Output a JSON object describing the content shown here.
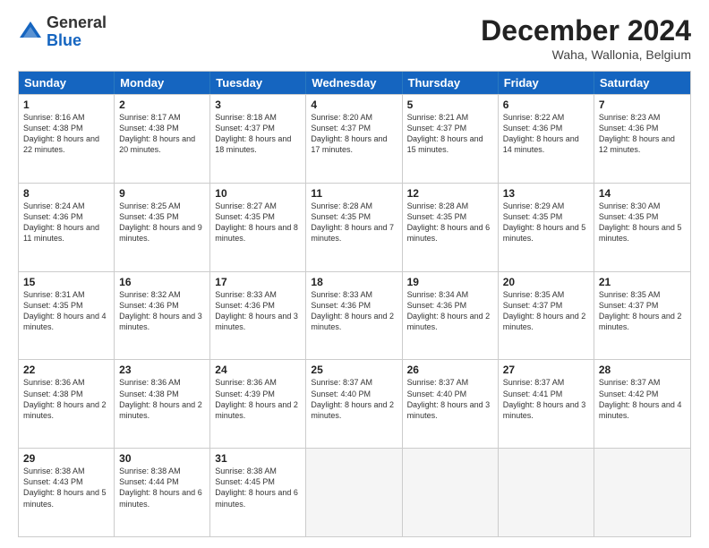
{
  "logo": {
    "general": "General",
    "blue": "Blue"
  },
  "title": "December 2024",
  "subtitle": "Waha, Wallonia, Belgium",
  "header_days": [
    "Sunday",
    "Monday",
    "Tuesday",
    "Wednesday",
    "Thursday",
    "Friday",
    "Saturday"
  ],
  "rows": [
    [
      {
        "day": "1",
        "info": "Sunrise: 8:16 AM\nSunset: 4:38 PM\nDaylight: 8 hours and 22 minutes."
      },
      {
        "day": "2",
        "info": "Sunrise: 8:17 AM\nSunset: 4:38 PM\nDaylight: 8 hours and 20 minutes."
      },
      {
        "day": "3",
        "info": "Sunrise: 8:18 AM\nSunset: 4:37 PM\nDaylight: 8 hours and 18 minutes."
      },
      {
        "day": "4",
        "info": "Sunrise: 8:20 AM\nSunset: 4:37 PM\nDaylight: 8 hours and 17 minutes."
      },
      {
        "day": "5",
        "info": "Sunrise: 8:21 AM\nSunset: 4:37 PM\nDaylight: 8 hours and 15 minutes."
      },
      {
        "day": "6",
        "info": "Sunrise: 8:22 AM\nSunset: 4:36 PM\nDaylight: 8 hours and 14 minutes."
      },
      {
        "day": "7",
        "info": "Sunrise: 8:23 AM\nSunset: 4:36 PM\nDaylight: 8 hours and 12 minutes."
      }
    ],
    [
      {
        "day": "8",
        "info": "Sunrise: 8:24 AM\nSunset: 4:36 PM\nDaylight: 8 hours and 11 minutes."
      },
      {
        "day": "9",
        "info": "Sunrise: 8:25 AM\nSunset: 4:35 PM\nDaylight: 8 hours and 9 minutes."
      },
      {
        "day": "10",
        "info": "Sunrise: 8:27 AM\nSunset: 4:35 PM\nDaylight: 8 hours and 8 minutes."
      },
      {
        "day": "11",
        "info": "Sunrise: 8:28 AM\nSunset: 4:35 PM\nDaylight: 8 hours and 7 minutes."
      },
      {
        "day": "12",
        "info": "Sunrise: 8:28 AM\nSunset: 4:35 PM\nDaylight: 8 hours and 6 minutes."
      },
      {
        "day": "13",
        "info": "Sunrise: 8:29 AM\nSunset: 4:35 PM\nDaylight: 8 hours and 5 minutes."
      },
      {
        "day": "14",
        "info": "Sunrise: 8:30 AM\nSunset: 4:35 PM\nDaylight: 8 hours and 5 minutes."
      }
    ],
    [
      {
        "day": "15",
        "info": "Sunrise: 8:31 AM\nSunset: 4:35 PM\nDaylight: 8 hours and 4 minutes."
      },
      {
        "day": "16",
        "info": "Sunrise: 8:32 AM\nSunset: 4:36 PM\nDaylight: 8 hours and 3 minutes."
      },
      {
        "day": "17",
        "info": "Sunrise: 8:33 AM\nSunset: 4:36 PM\nDaylight: 8 hours and 3 minutes."
      },
      {
        "day": "18",
        "info": "Sunrise: 8:33 AM\nSunset: 4:36 PM\nDaylight: 8 hours and 2 minutes."
      },
      {
        "day": "19",
        "info": "Sunrise: 8:34 AM\nSunset: 4:36 PM\nDaylight: 8 hours and 2 minutes."
      },
      {
        "day": "20",
        "info": "Sunrise: 8:35 AM\nSunset: 4:37 PM\nDaylight: 8 hours and 2 minutes."
      },
      {
        "day": "21",
        "info": "Sunrise: 8:35 AM\nSunset: 4:37 PM\nDaylight: 8 hours and 2 minutes."
      }
    ],
    [
      {
        "day": "22",
        "info": "Sunrise: 8:36 AM\nSunset: 4:38 PM\nDaylight: 8 hours and 2 minutes."
      },
      {
        "day": "23",
        "info": "Sunrise: 8:36 AM\nSunset: 4:38 PM\nDaylight: 8 hours and 2 minutes."
      },
      {
        "day": "24",
        "info": "Sunrise: 8:36 AM\nSunset: 4:39 PM\nDaylight: 8 hours and 2 minutes."
      },
      {
        "day": "25",
        "info": "Sunrise: 8:37 AM\nSunset: 4:40 PM\nDaylight: 8 hours and 2 minutes."
      },
      {
        "day": "26",
        "info": "Sunrise: 8:37 AM\nSunset: 4:40 PM\nDaylight: 8 hours and 3 minutes."
      },
      {
        "day": "27",
        "info": "Sunrise: 8:37 AM\nSunset: 4:41 PM\nDaylight: 8 hours and 3 minutes."
      },
      {
        "day": "28",
        "info": "Sunrise: 8:37 AM\nSunset: 4:42 PM\nDaylight: 8 hours and 4 minutes."
      }
    ],
    [
      {
        "day": "29",
        "info": "Sunrise: 8:38 AM\nSunset: 4:43 PM\nDaylight: 8 hours and 5 minutes."
      },
      {
        "day": "30",
        "info": "Sunrise: 8:38 AM\nSunset: 4:44 PM\nDaylight: 8 hours and 6 minutes."
      },
      {
        "day": "31",
        "info": "Sunrise: 8:38 AM\nSunset: 4:45 PM\nDaylight: 8 hours and 6 minutes."
      },
      null,
      null,
      null,
      null
    ]
  ]
}
